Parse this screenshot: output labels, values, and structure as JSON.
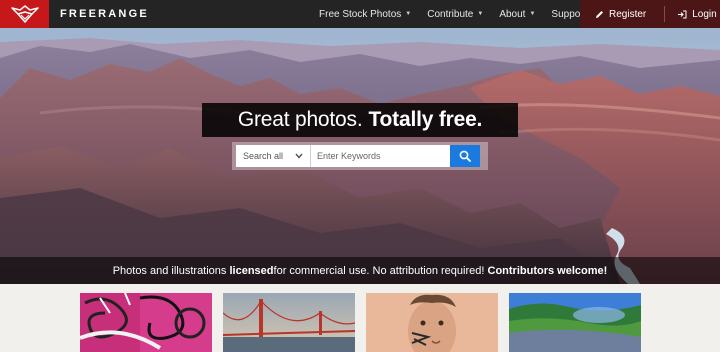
{
  "header": {
    "brand": "FREERANGE",
    "nav": [
      {
        "label": "Free Stock Photos",
        "has_dropdown": true
      },
      {
        "label": "Contribute",
        "has_dropdown": true
      },
      {
        "label": "About",
        "has_dropdown": true
      },
      {
        "label": "Support",
        "has_dropdown": true
      }
    ],
    "register_label": "Register",
    "login_label": "Login"
  },
  "hero": {
    "headline_light": "Great photos.",
    "headline_bold": "Totally free.",
    "search": {
      "scope_value": "Search all",
      "placeholder": "Enter Keywords"
    },
    "tagline": {
      "part1": "Photos and illustrations ",
      "bold1": "licensed",
      "part2": " for commercial use. No attribution required! ",
      "bold2": "Contributors welcome!"
    }
  },
  "thumbnails": [
    {
      "subject": "graffiti-art"
    },
    {
      "subject": "golden-gate-bridge"
    },
    {
      "subject": "painted-face-portrait"
    },
    {
      "subject": "wildflower-field"
    }
  ],
  "colors": {
    "nav_bg": "#242424",
    "logo_red": "#c6171b",
    "account_bg": "#4d1616",
    "search_button": "#1a7ae0",
    "page_bg": "#f1f0ed"
  }
}
